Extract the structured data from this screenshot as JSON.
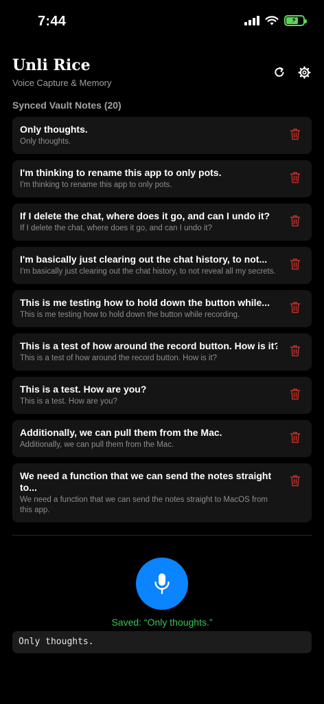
{
  "status_bar": {
    "time": "7:44",
    "battery_charging": true
  },
  "header": {
    "title": "Unli Rice",
    "subtitle": "Voice Capture & Memory"
  },
  "notes_section": {
    "label": "Synced Vault Notes (20)",
    "notes": [
      {
        "title": "Only thoughts.",
        "body": "Only thoughts."
      },
      {
        "title": "I'm thinking to rename this app to only pots.",
        "body": "I'm thinking to rename this app to only pots."
      },
      {
        "title": "If I delete the chat, where does it go, and can I undo it?",
        "body": "If I delete the chat, where does it go, and can I undo it?"
      },
      {
        "title": "I'm basically just clearing out the chat history, to not...",
        "body": "I'm basically just clearing out the chat history, to not reveal all my secrets."
      },
      {
        "title": "This is me testing how to hold down the button while...",
        "body": "This is me testing how to hold down the button while recording."
      },
      {
        "title": "This is a test of how around the record button. How is it?",
        "body": "This is a test of how around the record button. How is it?"
      },
      {
        "title": "This is a test. How are you?",
        "body": "This is a test. How are you?"
      },
      {
        "title": "Additionally, we can pull them from the Mac.",
        "body": "Additionally, we can pull them from the Mac."
      },
      {
        "title": "We need a function that we can send the notes straight to...",
        "body": "We need a function that we can send the notes straight to MacOS from this app."
      }
    ]
  },
  "recorder": {
    "saved_status": "Saved: “Only thoughts.”",
    "transcript": "Only thoughts."
  },
  "colors": {
    "accent": "#0a84ff",
    "delete": "#c0302b",
    "success": "#34c759",
    "battery": "#5fd35a"
  },
  "icons": [
    "refresh-icon",
    "gear-icon",
    "trash-icon",
    "microphone-icon",
    "wifi-icon",
    "signal-icon",
    "battery-icon"
  ]
}
